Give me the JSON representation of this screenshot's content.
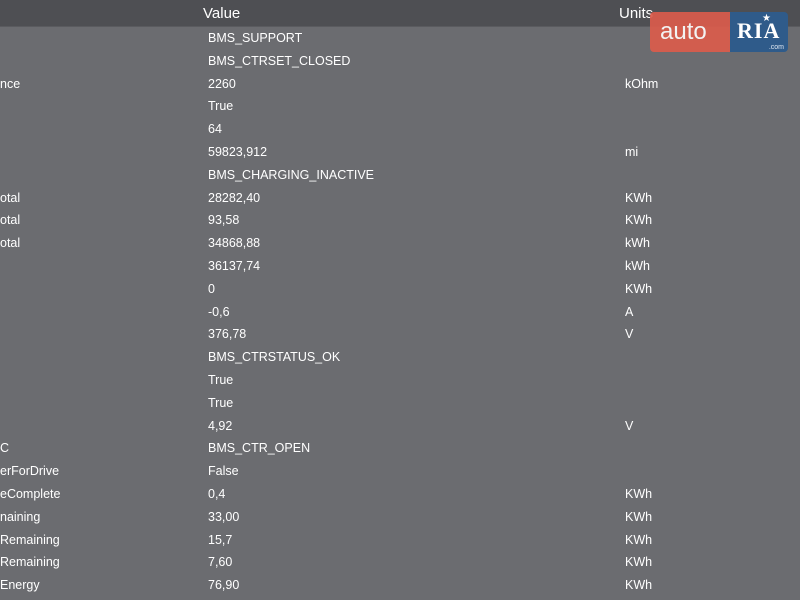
{
  "header": {
    "value_label": "Value",
    "units_label": "Units"
  },
  "logo": {
    "auto_text": "auto",
    "ria_text": "RIA",
    "com_text": ".com"
  },
  "rows": [
    {
      "name": "",
      "value": "BMS_SUPPORT",
      "unit": ""
    },
    {
      "name": "",
      "value": "BMS_CTRSET_CLOSED",
      "unit": ""
    },
    {
      "name": "nce",
      "value": "2260",
      "unit": "kOhm"
    },
    {
      "name": "",
      "value": "True",
      "unit": ""
    },
    {
      "name": "",
      "value": "64",
      "unit": ""
    },
    {
      "name": "",
      "value": "59823,912",
      "unit": "mi"
    },
    {
      "name": "",
      "value": "BMS_CHARGING_INACTIVE",
      "unit": ""
    },
    {
      "name": "otal",
      "value": "28282,40",
      "unit": "KWh"
    },
    {
      "name": "otal",
      "value": "93,58",
      "unit": "KWh"
    },
    {
      "name": "otal",
      "value": "34868,88",
      "unit": "kWh"
    },
    {
      "name": "",
      "value": "36137,74",
      "unit": "kWh"
    },
    {
      "name": "",
      "value": "0",
      "unit": "KWh"
    },
    {
      "name": "",
      "value": "-0,6",
      "unit": "A"
    },
    {
      "name": "",
      "value": "376,78",
      "unit": "V"
    },
    {
      "name": "",
      "value": "BMS_CTRSTATUS_OK",
      "unit": ""
    },
    {
      "name": "",
      "value": "True",
      "unit": ""
    },
    {
      "name": "",
      "value": "True",
      "unit": ""
    },
    {
      "name": "",
      "value": "4,92",
      "unit": "V"
    },
    {
      "name": "C",
      "value": "BMS_CTR_OPEN",
      "unit": ""
    },
    {
      "name": "erForDrive",
      "value": "False",
      "unit": ""
    },
    {
      "name": "eComplete",
      "value": "0,4",
      "unit": "KWh"
    },
    {
      "name": "naining",
      "value": "33,00",
      "unit": "KWh"
    },
    {
      "name": "Remaining",
      "value": "15,7",
      "unit": "KWh"
    },
    {
      "name": "Remaining",
      "value": "7,60",
      "unit": "KWh"
    },
    {
      "name": "Energy",
      "value": "76,90",
      "unit": "KWh"
    }
  ]
}
